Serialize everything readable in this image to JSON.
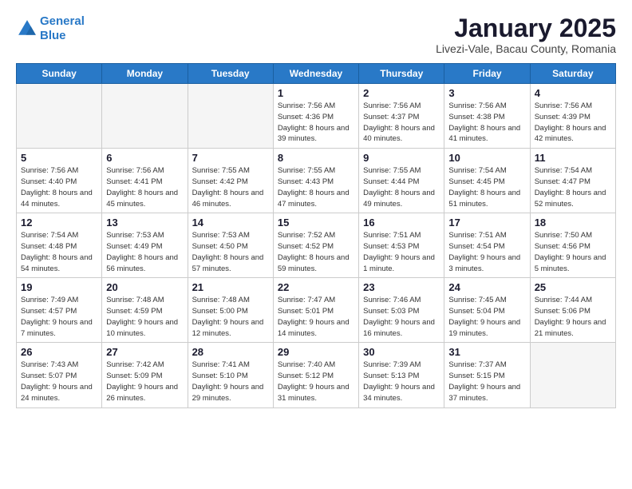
{
  "header": {
    "logo_line1": "General",
    "logo_line2": "Blue",
    "month": "January 2025",
    "location": "Livezi-Vale, Bacau County, Romania"
  },
  "weekdays": [
    "Sunday",
    "Monday",
    "Tuesday",
    "Wednesday",
    "Thursday",
    "Friday",
    "Saturday"
  ],
  "weeks": [
    [
      {
        "day": "",
        "info": ""
      },
      {
        "day": "",
        "info": ""
      },
      {
        "day": "",
        "info": ""
      },
      {
        "day": "1",
        "info": "Sunrise: 7:56 AM\nSunset: 4:36 PM\nDaylight: 8 hours and 39 minutes."
      },
      {
        "day": "2",
        "info": "Sunrise: 7:56 AM\nSunset: 4:37 PM\nDaylight: 8 hours and 40 minutes."
      },
      {
        "day": "3",
        "info": "Sunrise: 7:56 AM\nSunset: 4:38 PM\nDaylight: 8 hours and 41 minutes."
      },
      {
        "day": "4",
        "info": "Sunrise: 7:56 AM\nSunset: 4:39 PM\nDaylight: 8 hours and 42 minutes."
      }
    ],
    [
      {
        "day": "5",
        "info": "Sunrise: 7:56 AM\nSunset: 4:40 PM\nDaylight: 8 hours and 44 minutes."
      },
      {
        "day": "6",
        "info": "Sunrise: 7:56 AM\nSunset: 4:41 PM\nDaylight: 8 hours and 45 minutes."
      },
      {
        "day": "7",
        "info": "Sunrise: 7:55 AM\nSunset: 4:42 PM\nDaylight: 8 hours and 46 minutes."
      },
      {
        "day": "8",
        "info": "Sunrise: 7:55 AM\nSunset: 4:43 PM\nDaylight: 8 hours and 47 minutes."
      },
      {
        "day": "9",
        "info": "Sunrise: 7:55 AM\nSunset: 4:44 PM\nDaylight: 8 hours and 49 minutes."
      },
      {
        "day": "10",
        "info": "Sunrise: 7:54 AM\nSunset: 4:45 PM\nDaylight: 8 hours and 51 minutes."
      },
      {
        "day": "11",
        "info": "Sunrise: 7:54 AM\nSunset: 4:47 PM\nDaylight: 8 hours and 52 minutes."
      }
    ],
    [
      {
        "day": "12",
        "info": "Sunrise: 7:54 AM\nSunset: 4:48 PM\nDaylight: 8 hours and 54 minutes."
      },
      {
        "day": "13",
        "info": "Sunrise: 7:53 AM\nSunset: 4:49 PM\nDaylight: 8 hours and 56 minutes."
      },
      {
        "day": "14",
        "info": "Sunrise: 7:53 AM\nSunset: 4:50 PM\nDaylight: 8 hours and 57 minutes."
      },
      {
        "day": "15",
        "info": "Sunrise: 7:52 AM\nSunset: 4:52 PM\nDaylight: 8 hours and 59 minutes."
      },
      {
        "day": "16",
        "info": "Sunrise: 7:51 AM\nSunset: 4:53 PM\nDaylight: 9 hours and 1 minute."
      },
      {
        "day": "17",
        "info": "Sunrise: 7:51 AM\nSunset: 4:54 PM\nDaylight: 9 hours and 3 minutes."
      },
      {
        "day": "18",
        "info": "Sunrise: 7:50 AM\nSunset: 4:56 PM\nDaylight: 9 hours and 5 minutes."
      }
    ],
    [
      {
        "day": "19",
        "info": "Sunrise: 7:49 AM\nSunset: 4:57 PM\nDaylight: 9 hours and 7 minutes."
      },
      {
        "day": "20",
        "info": "Sunrise: 7:48 AM\nSunset: 4:59 PM\nDaylight: 9 hours and 10 minutes."
      },
      {
        "day": "21",
        "info": "Sunrise: 7:48 AM\nSunset: 5:00 PM\nDaylight: 9 hours and 12 minutes."
      },
      {
        "day": "22",
        "info": "Sunrise: 7:47 AM\nSunset: 5:01 PM\nDaylight: 9 hours and 14 minutes."
      },
      {
        "day": "23",
        "info": "Sunrise: 7:46 AM\nSunset: 5:03 PM\nDaylight: 9 hours and 16 minutes."
      },
      {
        "day": "24",
        "info": "Sunrise: 7:45 AM\nSunset: 5:04 PM\nDaylight: 9 hours and 19 minutes."
      },
      {
        "day": "25",
        "info": "Sunrise: 7:44 AM\nSunset: 5:06 PM\nDaylight: 9 hours and 21 minutes."
      }
    ],
    [
      {
        "day": "26",
        "info": "Sunrise: 7:43 AM\nSunset: 5:07 PM\nDaylight: 9 hours and 24 minutes."
      },
      {
        "day": "27",
        "info": "Sunrise: 7:42 AM\nSunset: 5:09 PM\nDaylight: 9 hours and 26 minutes."
      },
      {
        "day": "28",
        "info": "Sunrise: 7:41 AM\nSunset: 5:10 PM\nDaylight: 9 hours and 29 minutes."
      },
      {
        "day": "29",
        "info": "Sunrise: 7:40 AM\nSunset: 5:12 PM\nDaylight: 9 hours and 31 minutes."
      },
      {
        "day": "30",
        "info": "Sunrise: 7:39 AM\nSunset: 5:13 PM\nDaylight: 9 hours and 34 minutes."
      },
      {
        "day": "31",
        "info": "Sunrise: 7:37 AM\nSunset: 5:15 PM\nDaylight: 9 hours and 37 minutes."
      },
      {
        "day": "",
        "info": ""
      }
    ]
  ]
}
